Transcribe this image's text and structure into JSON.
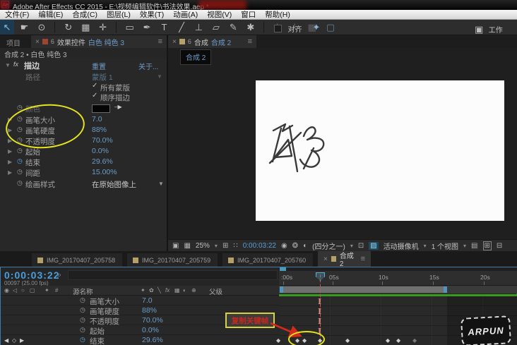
{
  "title_bar": {
    "app_initials": "Ae",
    "title": "Adobe After Effects CC 2015 - E:\\视频编辑软件\\书法效果.aep *"
  },
  "menu_bar": {
    "items": [
      "文件(F)",
      "编辑(E)",
      "合成(C)",
      "图层(L)",
      "效果(T)",
      "动画(A)",
      "视图(V)",
      "窗口",
      "帮助(H)"
    ]
  },
  "toolbar": {
    "tools": [
      {
        "name": "selection-tool",
        "glyph": "↖"
      },
      {
        "name": "hand-tool",
        "glyph": "☛"
      },
      {
        "name": "zoom-tool",
        "glyph": "⊙"
      },
      {
        "name": "rotate-tool",
        "glyph": "↻"
      },
      {
        "name": "camera-tool",
        "glyph": "▦"
      },
      {
        "name": "pan-behind-tool",
        "glyph": "✛"
      },
      {
        "name": "shape-tool",
        "glyph": "▭"
      },
      {
        "name": "pen-tool",
        "glyph": "✒"
      },
      {
        "name": "text-tool",
        "glyph": "T"
      },
      {
        "name": "brush-tool",
        "glyph": "╱"
      },
      {
        "name": "clone-stamp-tool",
        "glyph": "⊥"
      },
      {
        "name": "eraser-tool",
        "glyph": "▱"
      },
      {
        "name": "roto-brush-tool",
        "glyph": "✎"
      },
      {
        "name": "puppet-pin-tool",
        "glyph": "✱"
      }
    ],
    "dim_tools": [
      "⅄",
      "⅄",
      "▦"
    ],
    "snap_label": "对齐",
    "snap_icons": [
      "✦",
      "▢"
    ],
    "workspace_icon": "▣",
    "workspace_label": "工作"
  },
  "icons": {
    "close": "×",
    "menu": "≡",
    "lock": "6",
    "arrow_right": "▶",
    "arrow_down": "▼",
    "dropdown": "▾",
    "check": "✓",
    "stopwatch": "◷",
    "search": "⌕",
    "eyedropper": "–▶",
    "eye": "◉",
    "speaker": "◁",
    "solo": "○",
    "lockcol": "▢",
    "tag": "✦",
    "hash": "#",
    "shy": "✦",
    "flower": "✿",
    "slash": "╲",
    "fx": "fx",
    "grid": "▦",
    "half": "◐",
    "plus": "⊕",
    "kf_prev": "◀",
    "kf_mid": "◇",
    "kf_next": "▶",
    "diamond": "◆",
    "ibeam": "I",
    "snapshot": "▣",
    "showsnap": "▦",
    "gridv": "⊞",
    "margins": "∷",
    "cam": "◉",
    "mblur": "❂",
    "roi": "⊡",
    "transp": "▨",
    "panel1": "▤",
    "panel2": "⊞",
    "panel3": "⊟"
  },
  "effect_panel": {
    "tab_project": "项目",
    "tab_active": "效果控件",
    "tab_active_target": "白色 纯色 3",
    "breadcrumb": "合成 2 • 白色 纯色 3",
    "fx_label": "fx",
    "effect_name": "描边",
    "reset_label": "重置",
    "about_label": "关于...",
    "path_label": "路径",
    "path_value": "蒙版 1",
    "check_all_masks": "所有蒙版",
    "check_sequential": "顺序描边",
    "color_label": "颜色",
    "rows": [
      {
        "label": "画笔大小",
        "value": "7.0"
      },
      {
        "label": "画笔硬度",
        "value": "88%"
      },
      {
        "label": "不透明度",
        "value": "70.0%"
      },
      {
        "label": "起始",
        "value": "0.0%"
      },
      {
        "label": "结束",
        "value": "29.6%"
      },
      {
        "label": "间距",
        "value": "15.00%"
      }
    ],
    "style_label": "绘画样式",
    "style_value": "在原始图像上"
  },
  "comp_panel": {
    "tab_label": "合成",
    "tab_name": "合成 2",
    "tooltip": "合成 2",
    "zoom": "25%",
    "time": "0:00:03:22",
    "resolution": "(四分之一)",
    "camera": "活动摄像机",
    "views": "1 个视图"
  },
  "timeline": {
    "tabs": [
      {
        "label": "IMG_20170407_205758"
      },
      {
        "label": "IMG_20170407_205759"
      },
      {
        "label": "IMG_20170407_205760"
      },
      {
        "label": "合成 2"
      }
    ],
    "time": "0:00:03:22",
    "frames": "00097 (25.00 fps)",
    "col_source": "源名称",
    "col_parent": "父级",
    "rows": [
      {
        "label": "画笔大小",
        "value": "7.0"
      },
      {
        "label": "画笔硬度",
        "value": "88%"
      },
      {
        "label": "不透明度",
        "value": "70.0%"
      },
      {
        "label": "起始",
        "value": "0.0%"
      },
      {
        "label": "结束",
        "value": "29.6%"
      }
    ],
    "ruler_ticks": [
      ":00s",
      "05s",
      "10s",
      "15s",
      "20s"
    ],
    "annotation": "复制关键帧",
    "watermark": "ARPUN"
  },
  "colors": {
    "accent_blue": "#6f9cc8",
    "value_blue": "#6a9cc8",
    "time_blue": "#4a9edd",
    "annotation_yellow": "#e6e41c",
    "annotation_red": "#d42a1e",
    "workarea_green": "#3a9a1e",
    "solid_swatch": "#9c4632",
    "footage_swatch": "#b5a06a"
  }
}
